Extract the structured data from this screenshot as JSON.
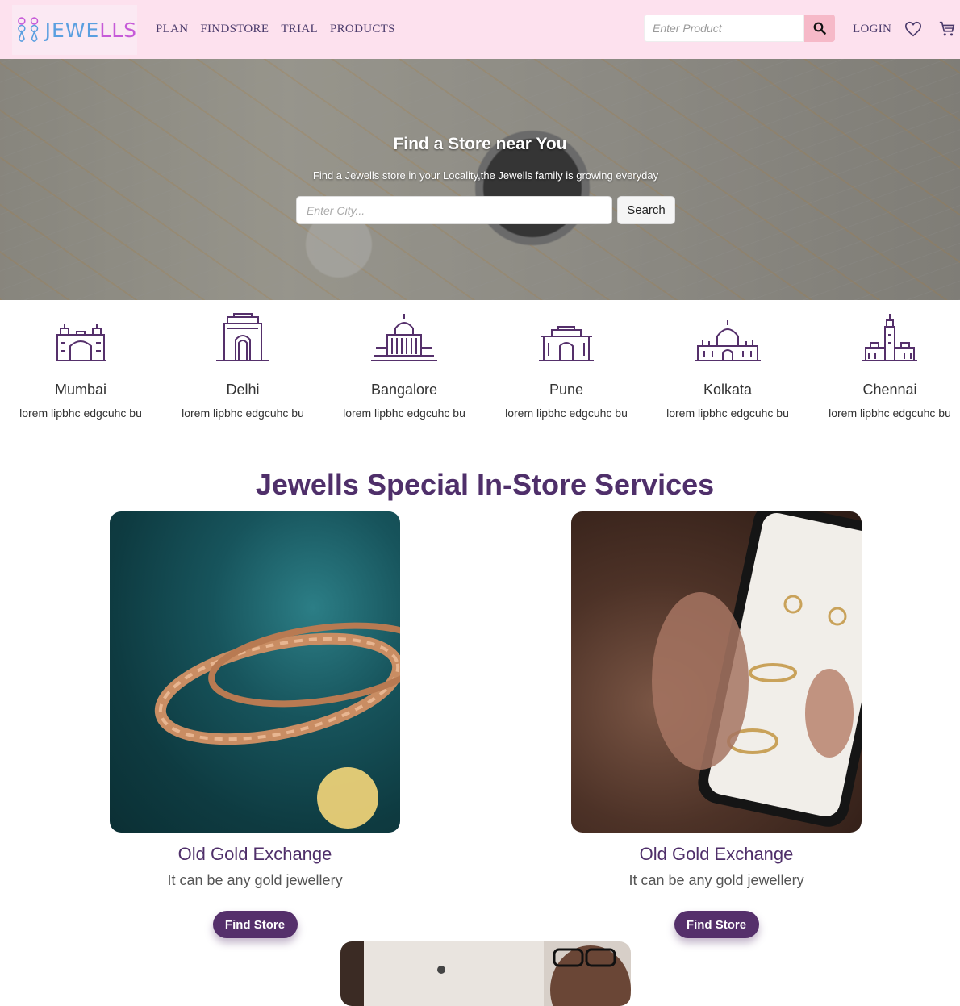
{
  "brand": {
    "name_part1": "JEWE",
    "name_part2": "LLS"
  },
  "nav": {
    "links": [
      "PLAN",
      "FINDSTORE",
      "TRIAL",
      "PRODUCTS"
    ],
    "search_placeholder": "Enter Product",
    "search_icon": "search-icon",
    "login_label": "LOGIN",
    "wishlist_icon": "heart-icon",
    "cart_icon": "cart-icon"
  },
  "hero": {
    "title": "Find a Store near You",
    "subtitle": "Find a Jewells store in your Locality,the Jewells family is growing everyday",
    "city_placeholder": "Enter City...",
    "search_label": "Search"
  },
  "cities": [
    {
      "name": "Mumbai",
      "desc": "lorem lipbhc edgcuhc bu",
      "icon": "gateway-of-india-icon"
    },
    {
      "name": "Delhi",
      "desc": "lorem lipbhc edgcuhc bu",
      "icon": "india-gate-icon"
    },
    {
      "name": "Bangalore",
      "desc": "lorem lipbhc edgcuhc bu",
      "icon": "vidhana-soudha-icon"
    },
    {
      "name": "Pune",
      "desc": "lorem lipbhc edgcuhc bu",
      "icon": "shaniwar-wada-icon"
    },
    {
      "name": "Kolkata",
      "desc": "lorem lipbhc edgcuhc bu",
      "icon": "victoria-memorial-icon"
    },
    {
      "name": "Chennai",
      "desc": "lorem lipbhc edgcuhc bu",
      "icon": "chennai-landmark-icon"
    }
  ],
  "services": {
    "title": "Jewells Special In-Store Services",
    "cards": [
      {
        "title": "Old Gold Exchange",
        "subtitle": "It can be any gold jewellery",
        "button": "Find Store"
      },
      {
        "title": "Old Gold Exchange",
        "subtitle": "It can be any gold jewellery",
        "button": "Find Store"
      }
    ]
  },
  "colors": {
    "nav_bg": "#fde1ee",
    "accent": "#55306b",
    "search_btn": "#f6b9c8"
  }
}
